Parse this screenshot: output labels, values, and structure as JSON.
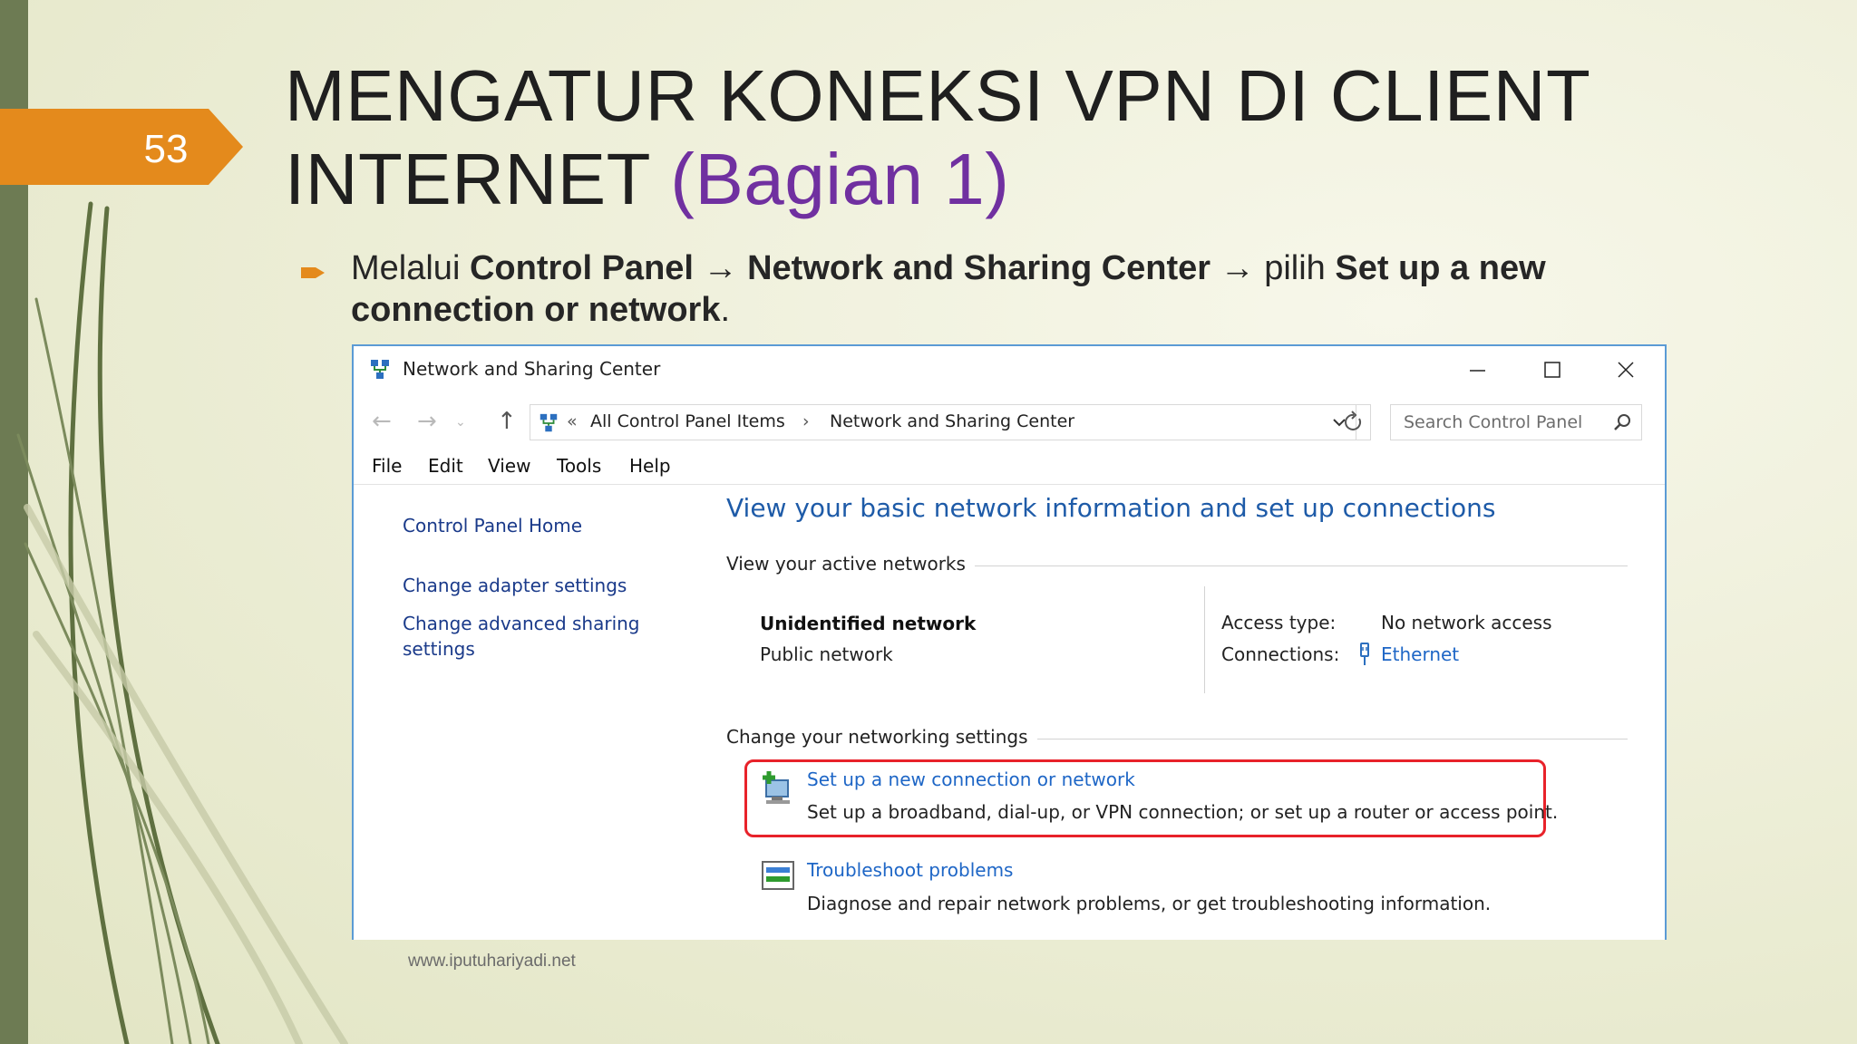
{
  "slide": {
    "number": "53",
    "title_main": "MENGATUR KONEKSI VPN DI CLIENT INTERNET",
    "title_accent": "(Bagian 1)",
    "bullet": {
      "t1": "Melalui ",
      "b1": "Control Panel",
      "a1": " → ",
      "b2": "Network and Sharing Center",
      "a2": " → pilih ",
      "b3": "Set up a new connection or network",
      "t2": "."
    },
    "footer": "www.iputuhariyadi.net",
    "colors": {
      "accent": "#7030a0",
      "tab": "#e48a1c",
      "left_bar": "#6d7b53"
    }
  },
  "window": {
    "title": "Network and Sharing Center",
    "address": {
      "prefix": "«",
      "crumb1": "All Control Panel Items",
      "sep": "›",
      "crumb2": "Network and Sharing Center"
    },
    "search_placeholder": "Search Control Panel",
    "menu": [
      "File",
      "Edit",
      "View",
      "Tools",
      "Help"
    ],
    "sidebar": {
      "home": "Control Panel Home",
      "adapter": "Change adapter settings",
      "advanced": "Change advanced sharing settings"
    },
    "main": {
      "heading": "View your basic network information and set up connections",
      "active_networks": "View your active networks",
      "network_name": "Unidentified network",
      "network_type": "Public network",
      "access_type_label": "Access type:",
      "access_type_value": "No network access",
      "connections_label": "Connections:",
      "connections_value": "Ethernet",
      "change_settings": "Change your networking settings",
      "setup_link": "Set up a new connection or network",
      "setup_desc": "Set up a broadband, dial-up, or VPN connection; or set up a router or access point.",
      "troubleshoot_link": "Troubleshoot problems",
      "troubleshoot_desc": "Diagnose and repair network problems, or get troubleshooting information."
    }
  }
}
